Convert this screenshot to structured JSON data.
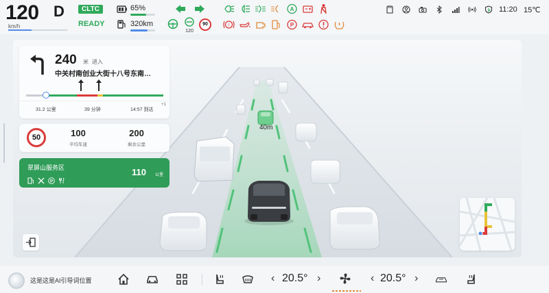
{
  "cluster": {
    "speed": "120",
    "speed_unit": "km/h",
    "speed_fraction": 0.4,
    "gear": "D",
    "cycle_badge": "CLTC",
    "ready_label": "READY",
    "battery_percent": "65%",
    "battery_level": 0.65,
    "range": "320km",
    "range_level": 0.7,
    "speed_limit_sign": "90",
    "traffic_sign_value": "120"
  },
  "status": {
    "time": "11:20",
    "temperature": "15℃"
  },
  "navigation": {
    "distance": "240",
    "distance_unit": "米",
    "action": "进入",
    "road": "中关村南创业大街十八号东南…",
    "remaining_distance": "31.2 公里",
    "remaining_time": "39 分钟",
    "arrival": "14:57 到达",
    "arrival_day_offset": "+1"
  },
  "speed_info": {
    "limit": "50",
    "avg_speed": "100",
    "avg_speed_label": "平均车速",
    "remaining": "200",
    "remaining_label": "剩余公里"
  },
  "service_area": {
    "name": "翠屏山服务区",
    "distance": "110",
    "unit": "公里",
    "facilities": [
      "fuel-icon",
      "repair-icon",
      "parking-icon",
      "restaurant-icon"
    ]
  },
  "scene": {
    "follow_distance": "40m"
  },
  "dock": {
    "ai_placeholder": "这是这是AI引导词位置",
    "driver_temp": "20.5°",
    "passenger_temp": "20.5°"
  },
  "colors": {
    "accent_green": "#2faa5a",
    "accent_blue": "#4f8be8",
    "warning_red": "#d93a3a",
    "warning_orange": "#e28a3a"
  }
}
